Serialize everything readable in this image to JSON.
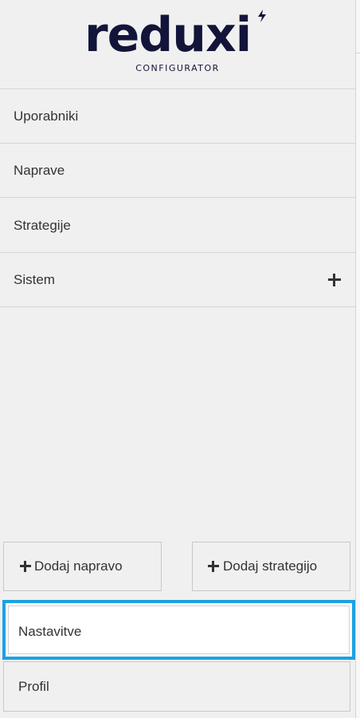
{
  "brand": {
    "name": "reduxi",
    "subtitle": "CONFIGURATOR",
    "color": "#13143a"
  },
  "nav": {
    "items": [
      {
        "label": "Uporabniki"
      },
      {
        "label": "Naprave"
      },
      {
        "label": "Strategije"
      },
      {
        "label": "Sistem",
        "icon": "plus-icon"
      }
    ]
  },
  "actions": {
    "add_device": "Dodaj napravo",
    "add_strategy": "Dodaj strategijo"
  },
  "bottom": {
    "settings": "Nastavitve",
    "profile": "Profil"
  },
  "colors": {
    "accent": "#1da1e2",
    "background": "#f0f0f0",
    "text": "#333333"
  }
}
